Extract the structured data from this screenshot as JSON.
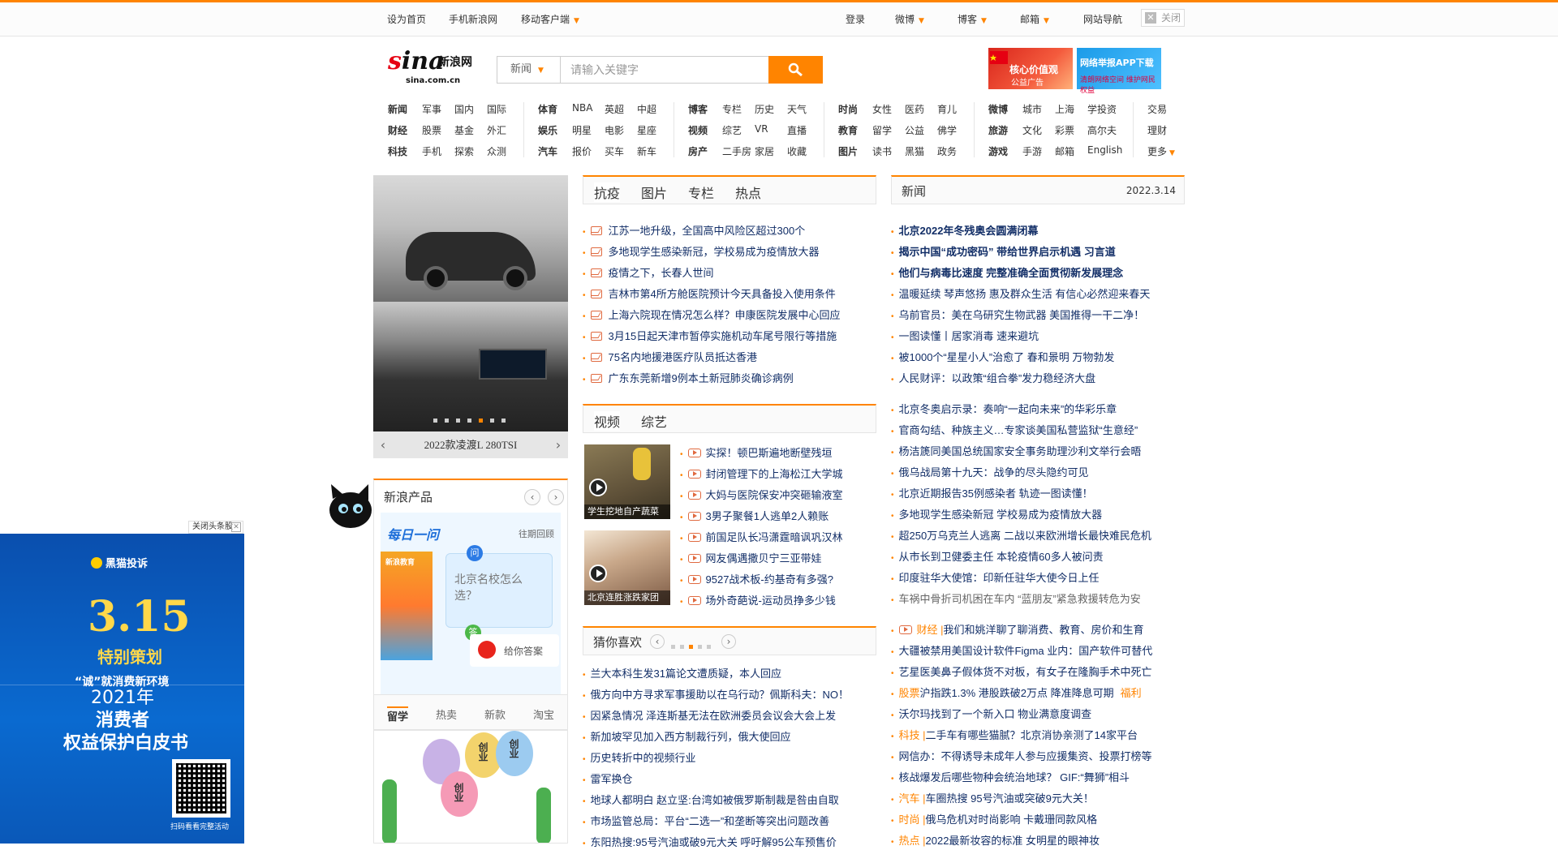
{
  "topbar": {
    "set_home": "设为首页",
    "mobile_site": "手机新浪网",
    "mobile_client": "移动客户端",
    "login": "登录",
    "weibo": "微博",
    "blog": "博客",
    "mail": "邮箱",
    "site_nav": "网站导航",
    "close": "关闭"
  },
  "logo": {
    "text": "sina",
    "cn": "新浪网",
    "domain": "sina.com.cn"
  },
  "search": {
    "category": "新闻",
    "placeholder": "请输入关键字"
  },
  "banners": {
    "core_values": "核心价值观",
    "public_ad": "公益广告",
    "report_app": "网络举报APP下载",
    "report_sub": "清朗网络空间 维护网民权益"
  },
  "nav": {
    "col1": [
      [
        "新闻",
        "军事",
        "国内",
        "国际"
      ],
      [
        "财经",
        "股票",
        "基金",
        "外汇"
      ],
      [
        "科技",
        "手机",
        "探索",
        "众测"
      ]
    ],
    "col2": [
      [
        "体育",
        "NBA",
        "英超",
        "中超"
      ],
      [
        "娱乐",
        "明星",
        "电影",
        "星座"
      ],
      [
        "汽车",
        "报价",
        "买车",
        "新车"
      ]
    ],
    "col3": [
      [
        "博客",
        "专栏",
        "历史",
        "天气"
      ],
      [
        "视频",
        "综艺",
        "VR",
        "直播"
      ],
      [
        "房产",
        "二手房",
        "家居",
        "收藏"
      ]
    ],
    "col4": [
      [
        "时尚",
        "女性",
        "医药",
        "育儿"
      ],
      [
        "教育",
        "留学",
        "公益",
        "佛学"
      ],
      [
        "图片",
        "读书",
        "黑猫",
        "政务"
      ]
    ],
    "col5": [
      [
        "微博",
        "城市",
        "上海",
        "学投资"
      ],
      [
        "旅游",
        "文化",
        "彩票",
        "高尔夫"
      ],
      [
        "游戏",
        "手游",
        "邮箱",
        "English"
      ]
    ],
    "col6": [
      "交易",
      "理财",
      "更多"
    ]
  },
  "slider": {
    "caption": "2022款凌渡L 280TSI"
  },
  "epidemic": {
    "tabs": [
      "抗疫",
      "图片",
      "专栏",
      "热点"
    ],
    "items": [
      "江苏一地升级，全国高中风险区超过300个",
      "多地现学生感染新冠，学校易成为疫情放大器",
      "疫情之下，长春人世间",
      "吉林市第4所方舱医院预计今天具备投入使用条件",
      "上海六院现在情况怎么样？申康医院发展中心回应",
      "3月15日起天津市暂停实施机动车尾号限行等措施",
      "75名内地援港医疗队员抵达香港",
      "广东东莞新增9例本土新冠肺炎确诊病例"
    ]
  },
  "video": {
    "tabs": [
      "视频",
      "综艺"
    ],
    "thumb1_caption": "学生挖地自产蔬菜",
    "thumb2_caption": "北京连胜涨跌家团",
    "items": [
      "实探！顿巴斯遍地断壁残垣",
      "封闭管理下的上海松江大学城",
      "大妈与医院保安冲突砸输液室",
      "3男子聚餐1人逃单2人赖账",
      "前国足队长冯潇霆暗讽巩汉林",
      "网友偶遇撒贝宁三亚带娃",
      "9527战术板-约基奇有多强?",
      "场外奇葩说-运动员挣多少钱"
    ]
  },
  "guess": {
    "title": "猜你喜欢",
    "items": [
      "兰大本科生发31篇论文遭质疑，本人回应",
      "俄方向中方寻求军事援助以在乌行动？佩斯科夫：NO！",
      "因紧急情况 泽连斯基无法在欧洲委员会议会大会上发",
      "新加坡罕见加入西方制裁行列，俄大使回应",
      "历史转折中的视频行业",
      "雷军换仓",
      "地球人都明白 赵立坚:台湾如被俄罗斯制裁是咎由自取",
      "市场监管总局：平台“二选一”和垄断等突出问题改善",
      "东阳热搜:95号汽油或破9元大关 呼吁解95公车预售价"
    ]
  },
  "news": {
    "title": "新闻",
    "date": "2022.3.14",
    "top": [
      "北京2022年冬残奥会圆满闭幕",
      "揭示中国“成功密码” 带给世界启示机遇 习言道",
      "他们与病毒比速度 完整准确全面贯彻新发展理念"
    ],
    "items1": [
      "温暖延续 琴声悠扬 惠及群众生活 有信心必然迎来春天",
      "乌前官员：美在乌研究生物武器 美国推得一干二净！",
      "一图读懂丨居家消毒 速来避坑",
      "被1000个“星星小人”治愈了 春和景明 万物勃发",
      "人民财评：以政策“组合拳”发力稳经济大盘"
    ],
    "items2": [
      "北京冬奥启示录：奏响“一起向未来”的华彩乐章",
      "官商勾结、种族主义…专家谈美国私营监狱“生意经”",
      "杨洁篪同美国总统国家安全事务助理沙利文举行会晤",
      "俄乌战局第十九天：战争的尽头隐约可见",
      "北京近期报告35例感染者 轨迹一图读懂！",
      "多地现学生感染新冠 学校易成为疫情放大器",
      "超250万乌克兰人逃离 二战以来欧洲增长最快难民危机",
      "从市长到卫健委主任 本轮疫情60多人被问责",
      "印度驻华大使馆：印新任驻华大使今日上任",
      "车祸中骨折司机困在车内 “蓝朋友”紧急救援转危为安"
    ],
    "items3": [
      {
        "tag": "财经 |",
        "text": "我们和姚洋聊了聊消费、教育、房价和生育"
      },
      {
        "tag": "",
        "text": "大疆被禁用美国设计软件Figma 业内：国产软件可替代"
      },
      {
        "tag": "",
        "text": "艺星医美鼻子假体货不对板，有女子在隆胸手术中死亡"
      },
      {
        "tag": "股票",
        "text": "沪指跌1.3% 港股跌破2万点 降准降息可期",
        "extra": "福利"
      },
      {
        "tag": "",
        "text": "沃尔玛找到了一个新入口 物业满意度调查"
      },
      {
        "tag": "科技 |",
        "text": "二手车有哪些猫腻？北京消协亲测了14家平台"
      },
      {
        "tag": "",
        "text": "网信办：不得诱导未成年人参与应援集资、投票打榜等"
      },
      {
        "tag": "",
        "text": "核战爆发后哪些物种会统治地球？ GIF:“舞狮”相斗"
      },
      {
        "tag": "汽车 |",
        "text": "车圈热搜 95号汽油或突破9元大关！"
      },
      {
        "tag": "时尚 |",
        "text": "俄乌危机对时尚影响 卡戴珊同款风格"
      },
      {
        "tag": "热点 |",
        "text": "2022最新妆容的标准 女明星的眼神妆"
      }
    ]
  },
  "products": {
    "title": "新浪产品",
    "daily_ask": "每日一问",
    "past": "往期回顾",
    "question": "北京名校怎么选？",
    "answer_btn": "给你答案",
    "edu": "新浪教育"
  },
  "study": {
    "tabs": [
      "留学",
      "热卖",
      "新款",
      "淘宝"
    ],
    "balloons": [
      "创业",
      "创业",
      "创业"
    ]
  },
  "ad": {
    "close": "关闭头条股",
    "brand": "黑猫投诉",
    "big": "3.15",
    "strategy": "特别策划",
    "slogan": "“诚”就消费新环境",
    "year": "2021年",
    "line2": "消费者",
    "line3": "权益保护白皮书",
    "qr_caption": "扫码看看完整活动"
  },
  "colors": {
    "accent": "#ff8400",
    "link": "#122e67",
    "ad_blue": "#0a5fc4"
  }
}
